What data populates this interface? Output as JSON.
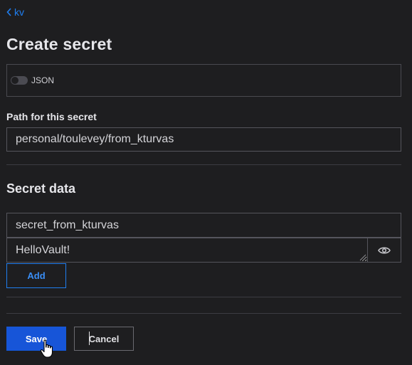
{
  "breadcrumb": {
    "label": "kv",
    "icon": "chevron-left-icon"
  },
  "page": {
    "title": "Create secret"
  },
  "json_toggle": {
    "label": "JSON",
    "enabled": false
  },
  "path": {
    "label": "Path for this secret",
    "value": "personal/toulevey/from_kturvas"
  },
  "secret_data": {
    "title": "Secret data",
    "key": "secret_from_kturvas",
    "value": "HelloVault!",
    "reveal_icon": "eye-icon",
    "add_label": "Add"
  },
  "actions": {
    "save_label": "Save",
    "cancel_label": "Cancel"
  },
  "colors": {
    "accent": "#1f7ef0",
    "primary_button": "#1755d8",
    "background": "#1e1e20"
  }
}
